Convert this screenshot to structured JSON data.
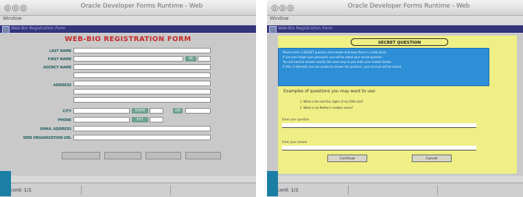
{
  "left": {
    "window_title": "Oracle Developer Forms Runtime - Web",
    "menu": "Window",
    "inner_title": "Web-Bio Registration Form",
    "form_title": "WEB-BIO REGISTRATION FORM",
    "labels": {
      "last_name": "LAST NAME",
      "first_name": "FIRST NAME",
      "agency": "AGENCY NAME",
      "address": "ADDRESS",
      "city": "CITY",
      "phone": "PHONE",
      "email": "EMAIL ADDRESS",
      "web_org": "WEB ORGANIZATION URL"
    },
    "sublabels": {
      "mi": "MI",
      "state": "STATE",
      "zip": "ZIP",
      "ext": "EXT"
    },
    "status_text": "Record: 1/1"
  },
  "right": {
    "window_title": "Oracle Developer Forms Runtime - Web",
    "menu": "Window",
    "inner_title": "Web-Bio Registration Form",
    "title": "SECRET QUESTION",
    "info_lines": [
      "Please enter a SECRET question and answer and keep them in a safe place.",
      "If you ever forget your password, you will be asked your secret question.",
      "You will need to answer exactly the same way as you enter your answer below.",
      "If after 3 attempts you are unable to answer the question, your account will be locked."
    ],
    "examples_label": "Examples of questions you may want to use:",
    "examples": [
      "1.  What is the last four digits of my SSN card?",
      "2.  What is my Mother's maiden name?"
    ],
    "question_label": "Enter your question",
    "answer_label": "Enter your answer",
    "buttons": [
      "Continue",
      "Cancel"
    ],
    "status_text": "Record: 1/1"
  }
}
